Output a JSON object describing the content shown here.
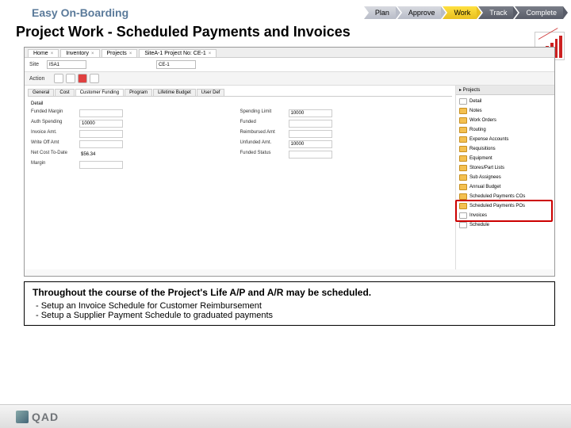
{
  "header": {
    "brand": "Easy On-Boarding",
    "steps": [
      "Plan",
      "Approve",
      "Work",
      "Track",
      "Complete"
    ]
  },
  "title": "Project Work - Scheduled Payments and Invoices",
  "app": {
    "top_tabs": [
      "Home",
      "Inventory",
      "Projects",
      "SiteA-1 Project No: CE-1"
    ],
    "site_label": "Site",
    "site_val": "ISA1",
    "pn_val": "CE-1",
    "action_label": "Action",
    "action_btn": "▾",
    "inner_tabs": [
      "General",
      "Cost",
      "Customer Funding",
      "Program",
      "Lifetime Budget",
      "User Def"
    ],
    "detail_head": "Detail",
    "left_rows": [
      {
        "l": "Funded Margin",
        "v": ""
      },
      {
        "l": "Auth Spending",
        "v": "10000"
      },
      {
        "l": "Invoice Amt.",
        "v": ""
      },
      {
        "l": "Write Off Amt",
        "v": ""
      },
      {
        "l": "Net Cost To-Date",
        "v": "$56.34"
      },
      {
        "l": "Margin",
        "v": ""
      }
    ],
    "right_rows": [
      {
        "l": "Spending Limit",
        "v": "10000"
      },
      {
        "l": "Funded",
        "v": ""
      },
      {
        "l": "Reimbursed Amt",
        "v": ""
      },
      {
        "l": "Unfunded Amt.",
        "v": "10000"
      },
      {
        "l": "Funded Status",
        "v": ""
      }
    ],
    "right_panel": {
      "head": "▸ Projects",
      "items": [
        "Detail",
        "Notes",
        "Work Orders",
        "Routing",
        "Expense Accounts",
        "Requisitions",
        "Equipment",
        "Stores/Part Lists",
        "Sub Assignees",
        "Annual Budget",
        "Scheduled Payments COs",
        "Scheduled Payments POs",
        "Invoices",
        "Schedule"
      ]
    }
  },
  "caption": {
    "bold": "Throughout the course of the Project's Life A/P and A/R may be scheduled.",
    "lines": [
      "- Setup an Invoice Schedule for Customer Reimbursement",
      "- Setup a Supplier Payment Schedule to graduated payments"
    ]
  },
  "footer": {
    "logo": "QAD"
  }
}
